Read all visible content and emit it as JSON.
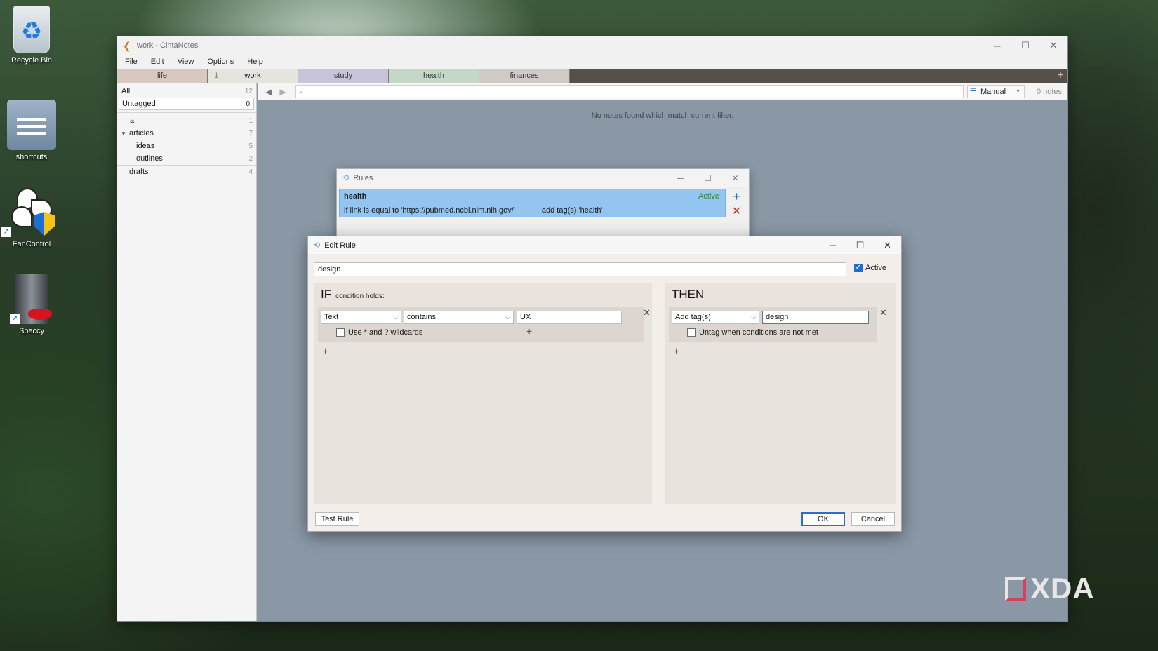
{
  "desktop": {
    "icons": [
      {
        "label": "Recycle Bin",
        "icon": "recycle-bin-icon"
      },
      {
        "label": "shortcuts",
        "icon": "folder-icon"
      },
      {
        "label": "FanControl",
        "icon": "fan-icon"
      },
      {
        "label": "Speccy",
        "icon": "speccy-icon"
      }
    ]
  },
  "main_window": {
    "title": "work - CintaNotes",
    "controls": {
      "minimize": "─",
      "maximize": "☐",
      "close": "✕"
    },
    "menu": [
      "File",
      "Edit",
      "View",
      "Options",
      "Help"
    ],
    "tabs": [
      {
        "label": "life",
        "color": "#d9c8bf"
      },
      {
        "label": "work",
        "color": "#e6e4de",
        "selected": true
      },
      {
        "label": "study",
        "color": "#c7c3d8"
      },
      {
        "label": "health",
        "color": "#c5d8c7"
      },
      {
        "label": "finances",
        "color": "#cfcac6"
      }
    ],
    "sidebar": {
      "all": {
        "label": "All",
        "count": "12"
      },
      "untagged": {
        "label": "Untagged",
        "count": "0"
      },
      "tags": [
        {
          "label": "a",
          "count": "1"
        },
        {
          "label": "articles",
          "count": "7"
        },
        {
          "label": "ideas",
          "count": "5"
        },
        {
          "label": "outlines",
          "count": "2"
        },
        {
          "label": "drafts",
          "count": "4"
        }
      ]
    },
    "toolbar": {
      "search_value": "",
      "sort_label": "Manual",
      "notes_count": "0 notes"
    },
    "empty_message": "No notes found which match current filter."
  },
  "rules_dialog": {
    "title": "Rules",
    "rule": {
      "name": "health",
      "status": "Active",
      "condition": "if link is equal to 'https://pubmed.ncbi.nlm.nih.gov/'",
      "action": "add tag(s) 'health'"
    }
  },
  "edit_rule_dialog": {
    "title": "Edit Rule",
    "name_value": "design",
    "active_label": "Active",
    "active_checked": true,
    "if_panel": {
      "title": "IF",
      "subtitle": "condition holds:",
      "field": "Text",
      "operator": "contains",
      "value": "UX",
      "wildcards_label": "Use * and ? wildcards"
    },
    "then_panel": {
      "title": "THEN",
      "action": "Add tag(s)",
      "value": "design",
      "untag_label": "Untag when conditions are not met"
    },
    "buttons": {
      "test": "Test Rule",
      "ok": "OK",
      "cancel": "Cancel"
    }
  },
  "watermark": "XDA"
}
